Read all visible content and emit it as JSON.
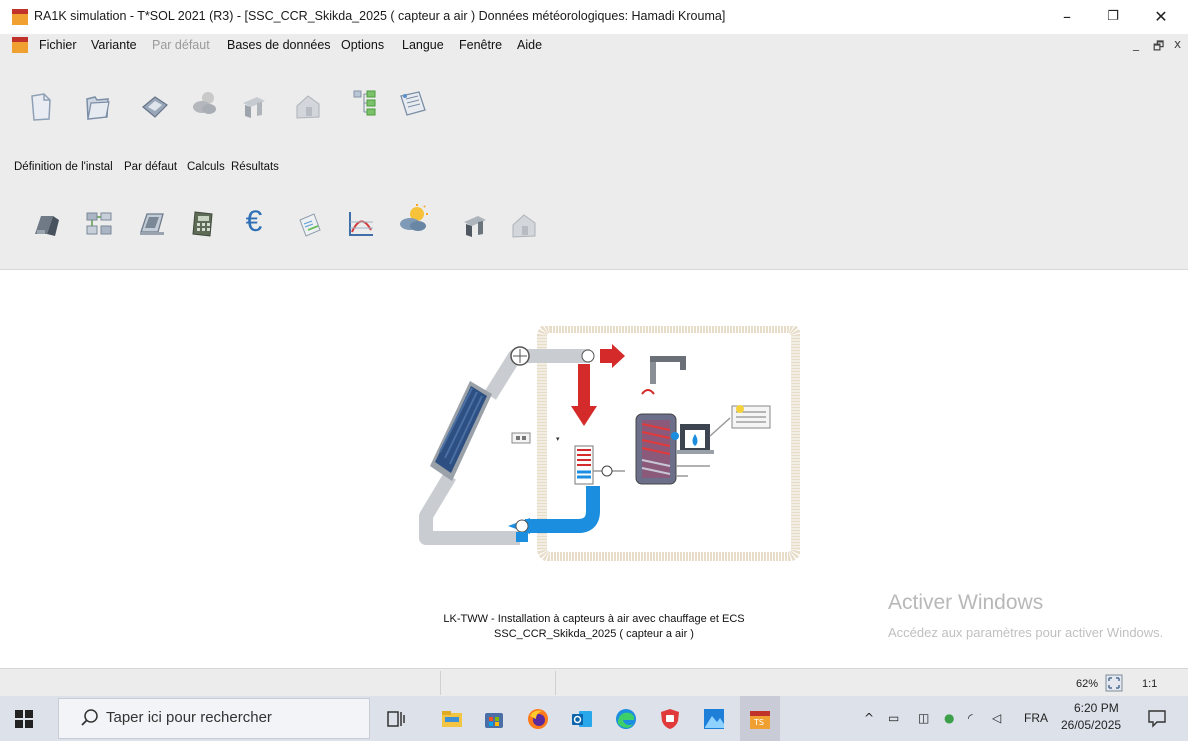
{
  "window": {
    "title": "RA1K simulation - T*SOL 2021 (R3) - [SSC_CCR_Skikda_2025 ( capteur a air )    Données météorologiques: Hamadi Krouma]",
    "controls": {
      "minimize": "–",
      "restore": "❐",
      "close": "✕"
    }
  },
  "menubar": {
    "items": [
      {
        "label": "Fichier",
        "enabled": true
      },
      {
        "label": "Variante",
        "enabled": true
      },
      {
        "label": "Par défaut",
        "enabled": false
      },
      {
        "label": "Bases de données",
        "enabled": true
      },
      {
        "label": "Options",
        "enabled": true
      },
      {
        "label": "Langue",
        "enabled": true
      },
      {
        "label": "Fenêtre",
        "enabled": true
      },
      {
        "label": "Aide",
        "enabled": true
      }
    ],
    "mdi_controls": {
      "minimize": "_",
      "restore": "🗗",
      "close": "x"
    }
  },
  "toolbar1": {
    "icons": [
      "new-file-icon",
      "open-folder-icon",
      "save-disk-icon",
      "weather-icon",
      "building-icon",
      "house-icon",
      "tree-view-icon",
      "report-icon"
    ]
  },
  "tabs": {
    "items": [
      "Définition de l'instal",
      "Par défaut",
      "Calculs",
      "Résultats"
    ]
  },
  "toolbar2": {
    "icons": [
      "system-icon",
      "components-icon",
      "collector-icon",
      "calculator-icon",
      "euro-icon",
      "export-icon",
      "graph-icon",
      "sun-cloud-icon",
      "building2-icon",
      "house2-icon"
    ],
    "euro_symbol": "€"
  },
  "main": {
    "caption_line1": "LK-TWW - Installation à capteurs à air avec chauffage et ECS",
    "caption_line2": "SSC_CCR_Skikda_2025 ( capteur a air )"
  },
  "watermark": {
    "title": "Activer Windows",
    "subtitle": "Accédez aux paramètres pour activer Windows."
  },
  "statusbar": {
    "zoom_percent": "62%",
    "zoom_one": "1:1"
  },
  "taskbar": {
    "search_placeholder": "Taper ici pour rechercher",
    "language": "FRA",
    "time": "6:20 PM",
    "date": "26/05/2025"
  },
  "colors": {
    "accent_red": "#d42a2a",
    "accent_blue": "#1b8ee0",
    "pipe_gray": "#c9ccd1",
    "frame_beige": "#e7dcc8"
  }
}
